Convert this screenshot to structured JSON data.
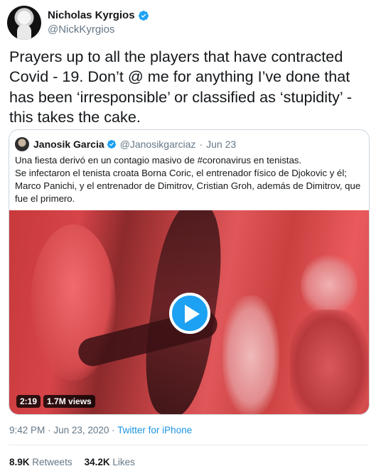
{
  "author": {
    "name": "Nicholas Kyrgios",
    "handle": "@NickKyrgios"
  },
  "tweet": {
    "text": "Prayers up to all the players that have contracted Covid - 19. Don’t @ me for anything I’ve done that has been ‘irresponsible’ or classified as ‘stupidity’ - this takes the cake."
  },
  "quoted": {
    "name": "Janosik Garcia",
    "handle": "@Janosikgarciaz",
    "date": "Jun 23",
    "text": "Una fiesta derivó en un contagio masivo de #coronavirus en tenistas.\nSe infectaron el tenista croata Borna Coric, el entrenador físico de Djokovic y él; Marco Panichi, y el entrenador de Dimitrov, Cristian Groh, además de Dimitrov, que fue el primero.",
    "video": {
      "duration": "2:19",
      "views": "1.7M views"
    }
  },
  "meta": {
    "time": "9:42 PM",
    "date": "Jun 23, 2020",
    "source": "Twitter for iPhone"
  },
  "stats": {
    "retweets_count": "8.9K",
    "retweets_label": "Retweets",
    "likes_count": "34.2K",
    "likes_label": "Likes"
  },
  "colors": {
    "accent": "#1da1f2",
    "link": "#1b95e0",
    "muted": "#657786"
  }
}
